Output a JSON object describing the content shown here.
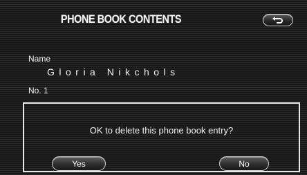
{
  "header": {
    "title": "PHONE BOOK CONTENTS",
    "back_icon": "back-arrow-icon"
  },
  "entry": {
    "name_label": "Name",
    "name_value": "Gloria Nikchols",
    "number_label": "No. 1"
  },
  "dialog": {
    "message": "OK to delete this phone book entry?",
    "yes_label": "Yes",
    "no_label": "No"
  }
}
